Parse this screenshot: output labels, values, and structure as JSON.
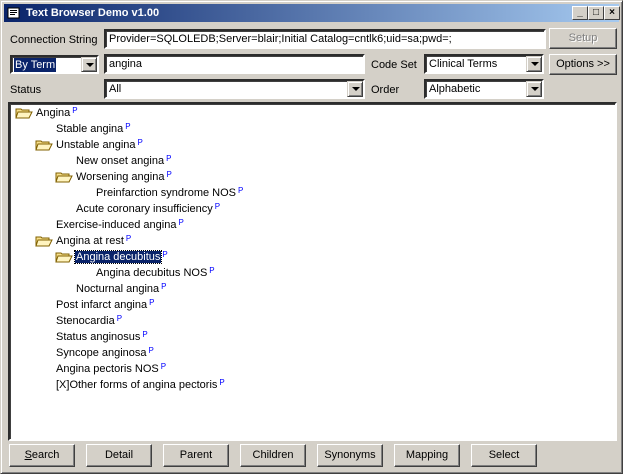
{
  "window": {
    "title": "Text Browser Demo v1.00"
  },
  "connection": {
    "label": "Connection String",
    "value": "Provider=SQLOLEDB;Server=blair;Initial Catalog=cntlk6;uid=sa;pwd=;",
    "setup_label": "Setup"
  },
  "search": {
    "mode": "By Term",
    "term": "angina",
    "code_set_label": "Code Set",
    "code_set": "Clinical Terms",
    "options_label": "Options >>",
    "status_label": "Status",
    "status": "All",
    "order_label": "Order",
    "order": "Alphabetic"
  },
  "tree": {
    "marker": "P",
    "nodes": [
      {
        "label": "Angina",
        "level": 0,
        "folder": true,
        "selected": false
      },
      {
        "label": "Stable angina",
        "level": 1,
        "folder": false,
        "selected": false
      },
      {
        "label": "Unstable angina",
        "level": 1,
        "folder": true,
        "selected": false
      },
      {
        "label": "New onset angina",
        "level": 2,
        "folder": false,
        "selected": false
      },
      {
        "label": "Worsening angina",
        "level": 2,
        "folder": true,
        "selected": false
      },
      {
        "label": "Preinfarction syndrome NOS",
        "level": 3,
        "folder": false,
        "selected": false
      },
      {
        "label": "Acute coronary insufficiency",
        "level": 2,
        "folder": false,
        "selected": false
      },
      {
        "label": "Exercise-induced angina",
        "level": 1,
        "folder": false,
        "selected": false
      },
      {
        "label": "Angina at rest",
        "level": 1,
        "folder": true,
        "selected": false
      },
      {
        "label": "Angina decubitus",
        "level": 2,
        "folder": true,
        "selected": true
      },
      {
        "label": "Angina decubitus NOS",
        "level": 3,
        "folder": false,
        "selected": false
      },
      {
        "label": "Nocturnal angina",
        "level": 2,
        "folder": false,
        "selected": false
      },
      {
        "label": "Post infarct angina",
        "level": 1,
        "folder": false,
        "selected": false
      },
      {
        "label": "Stenocardia",
        "level": 1,
        "folder": false,
        "selected": false
      },
      {
        "label": "Status anginosus",
        "level": 1,
        "folder": false,
        "selected": false
      },
      {
        "label": "Syncope anginosa",
        "level": 1,
        "folder": false,
        "selected": false
      },
      {
        "label": "Angina pectoris NOS",
        "level": 1,
        "folder": false,
        "selected": false
      },
      {
        "label": "[X]Other forms of angina pectoris",
        "level": 1,
        "folder": false,
        "selected": false
      }
    ]
  },
  "buttons": [
    {
      "label": "Search",
      "name": "search-button"
    },
    {
      "label": "Detail",
      "name": "detail-button"
    },
    {
      "label": "Parent",
      "name": "parent-button"
    },
    {
      "label": "Children",
      "name": "children-button"
    },
    {
      "label": "Synonyms",
      "name": "synonyms-button"
    },
    {
      "label": "Mapping",
      "name": "mapping-button"
    },
    {
      "label": "Select",
      "name": "select-button"
    }
  ]
}
